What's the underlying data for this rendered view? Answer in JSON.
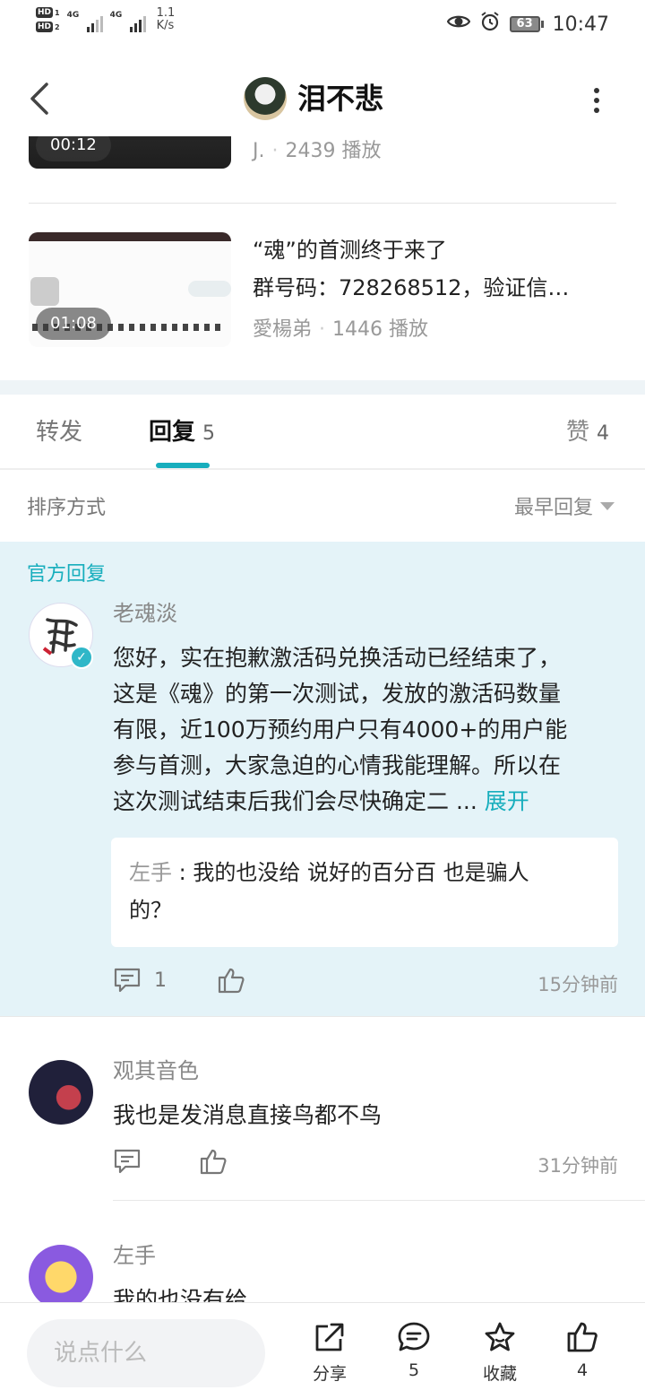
{
  "status_bar": {
    "hd1": "HD",
    "hd1_sub": "1",
    "hd2": "HD",
    "hd2_sub": "2",
    "net1": "4G",
    "net2": "4G",
    "speed_value": "1.1",
    "speed_unit": "K/s",
    "battery": "63",
    "time": "10:47"
  },
  "header": {
    "title": "泪不悲",
    "icons": [
      "back-icon",
      "avatar",
      "more-icon"
    ]
  },
  "videos": [
    {
      "duration": "00:12",
      "author": "J.",
      "plays": "2439 播放"
    },
    {
      "duration": "01:08",
      "title_line1": "“魂”的首测终于来了",
      "title_line2": "群号码：728268512，验证信…",
      "author": "愛楊弟",
      "plays": "1446 播放"
    }
  ],
  "tabs": {
    "forward": "转发",
    "reply": "回复",
    "reply_count": "5",
    "like": "赞",
    "like_count": "4"
  },
  "sort": {
    "label": "排序方式",
    "value": "最早回复"
  },
  "official_reply": {
    "section_label": "官方回复",
    "username": "老魂淡",
    "lines": [
      "您好，实在抱歉激活码兑换活动已经结束了，",
      "这是《魂》的第一次测试，发放的激活码数量",
      "有限，近100万预约用户只有4000+的用户能",
      "参与首测，大家急迫的心情我能理解。所以在",
      "这次测试结束后我们会尽快确定二 ..."
    ],
    "expand": "展开",
    "quote_author": "左手",
    "quote_colon": " : ",
    "quote_line1": "我的也没给 说好的百分百 也是骗人",
    "quote_line2": "的？",
    "reply_count": "1",
    "time": "15分钟前"
  },
  "comments": [
    {
      "username": "观其音色",
      "text": "我也是发消息直接鸟都不鸟",
      "time": "31分钟前"
    },
    {
      "username": "左手",
      "text": "我的也没有给"
    }
  ],
  "bottom_bar": {
    "input_placeholder": "说点什么",
    "share": "分享",
    "comments": "5",
    "favorite": "收藏",
    "likes": "4"
  },
  "colors": {
    "accent": "#17aebd",
    "official_bg": "#e4f3f8"
  }
}
